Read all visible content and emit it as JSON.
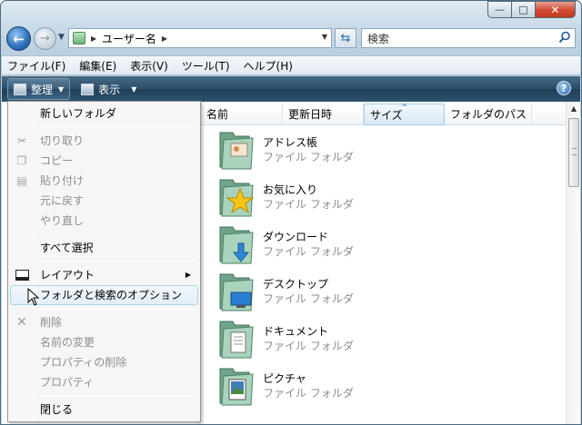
{
  "window": {
    "caption_buttons": {
      "minimize": "—",
      "maximize": "□",
      "close": "✕"
    }
  },
  "nav": {
    "address_crumb": "ユーザー名",
    "search_placeholder": "検索"
  },
  "menubar": [
    "ファイル(F)",
    "編集(E)",
    "表示(V)",
    "ツール(T)",
    "ヘルプ(H)"
  ],
  "commandbar": {
    "organize": "整理",
    "views": "表示",
    "help_icon": "?"
  },
  "columns": [
    "名前",
    "更新日時",
    "サイズ",
    "フォルダのパス"
  ],
  "files": [
    {
      "name": "アドレス帳",
      "type": "ファイル フォルダ",
      "icon": "contacts-folder-icon"
    },
    {
      "name": "お気に入り",
      "type": "ファイル フォルダ",
      "icon": "favorites-folder-icon"
    },
    {
      "name": "ダウンロード",
      "type": "ファイル フォルダ",
      "icon": "downloads-folder-icon"
    },
    {
      "name": "デスクトップ",
      "type": "ファイル フォルダ",
      "icon": "desktop-folder-icon"
    },
    {
      "name": "ドキュメント",
      "type": "ファイル フォルダ",
      "icon": "documents-folder-icon"
    },
    {
      "name": "ピクチャ",
      "type": "ファイル フォルダ",
      "icon": "pictures-folder-icon"
    }
  ],
  "menu": {
    "new_folder": "新しいフォルダ",
    "cut": "切り取り",
    "copy": "コピー",
    "paste": "貼り付け",
    "undo": "元に戻す",
    "redo": "やり直し",
    "select_all": "すべて選択",
    "layout": "レイアウト",
    "folder_options": "フォルダと検索のオプション",
    "delete": "削除",
    "rename": "名前の変更",
    "remove_properties": "プロパティの削除",
    "properties": "プロパティ",
    "close": "閉じる"
  }
}
